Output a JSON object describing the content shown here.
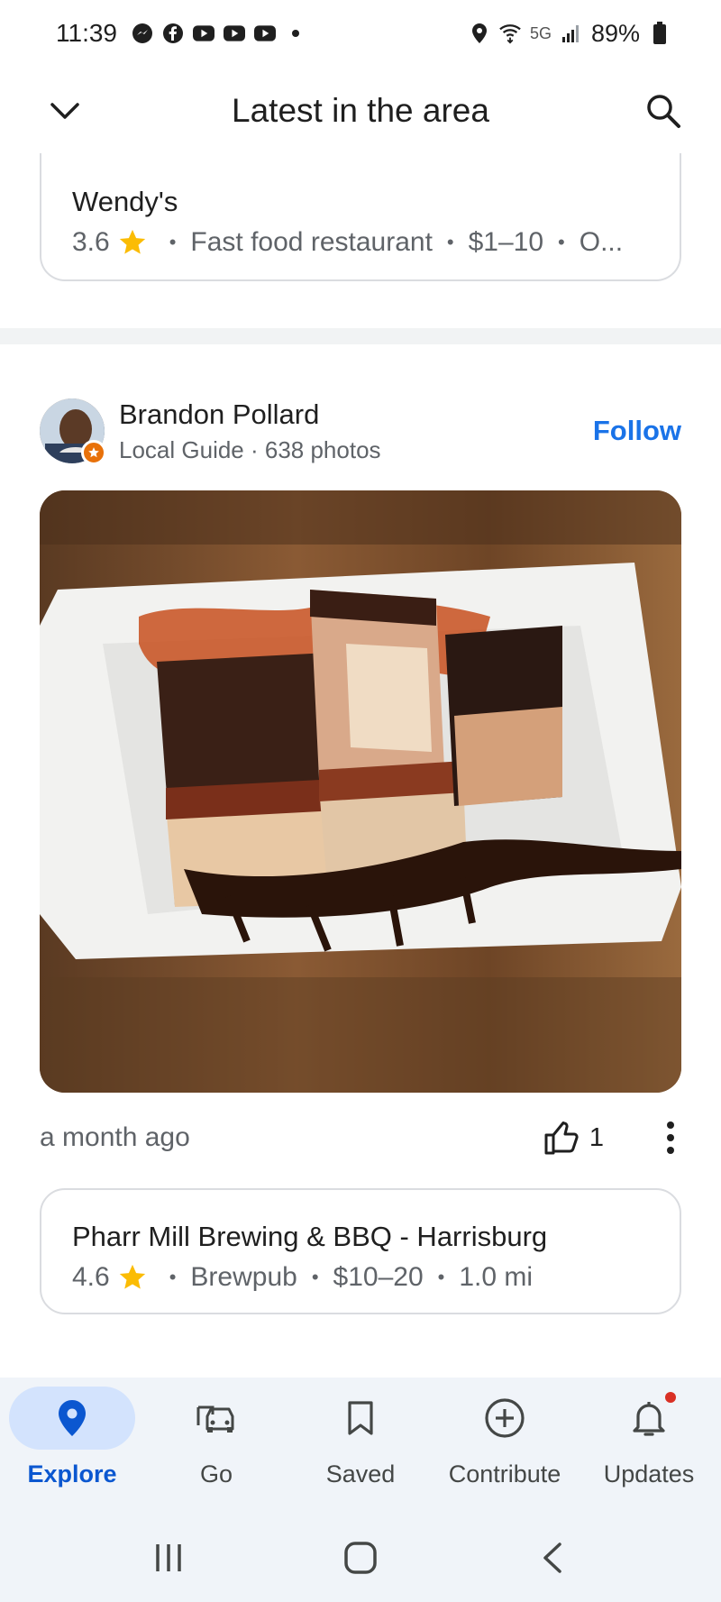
{
  "status_bar": {
    "time": "11:39",
    "network": "5G",
    "battery": "89%",
    "notification_icons": [
      "messenger-icon",
      "facebook-icon",
      "youtube-icon",
      "youtube-icon",
      "youtube-icon"
    ]
  },
  "header": {
    "title": "Latest in the area"
  },
  "top_place": {
    "name": "Wendy's",
    "rating": "3.6",
    "category": "Fast food restaurant",
    "price": "$1–10",
    "extra": "O..."
  },
  "post": {
    "author_name": "Brandon Pollard",
    "author_sub": "Local Guide · 638 photos",
    "follow_label": "Follow",
    "time": "a month ago",
    "likes": "1",
    "photo_description_icon": "food-photo"
  },
  "bottom_place": {
    "name": "Pharr Mill Brewing & BBQ - Harrisburg",
    "rating": "4.6",
    "category": "Brewpub",
    "price": "$10–20",
    "distance": "1.0 mi"
  },
  "nav": {
    "items": [
      {
        "label": "Explore",
        "icon": "pin-icon",
        "active": true
      },
      {
        "label": "Go",
        "icon": "car-icon",
        "active": false
      },
      {
        "label": "Saved",
        "icon": "bookmark-icon",
        "active": false
      },
      {
        "label": "Contribute",
        "icon": "add-circle-icon",
        "active": false
      },
      {
        "label": "Updates",
        "icon": "bell-icon",
        "active": false
      }
    ]
  },
  "colors": {
    "accent": "#1a73e8",
    "active_nav": "#0b57d0",
    "star": "#fbbc04",
    "badge": "#e8710a",
    "nav_bg": "#f0f4f9"
  }
}
